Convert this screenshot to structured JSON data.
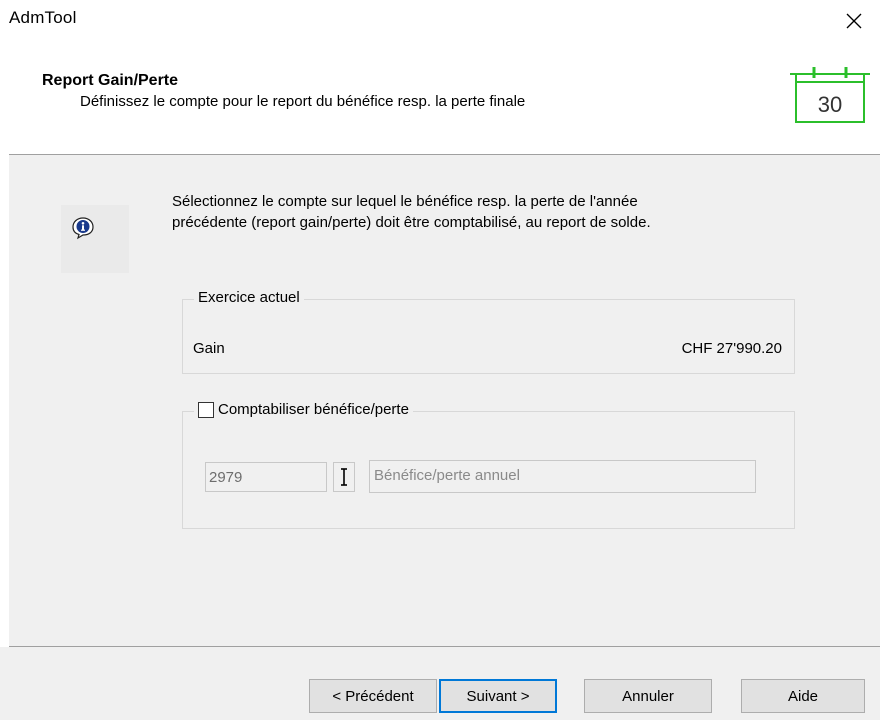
{
  "window": {
    "title": "AdmTool",
    "close_icon": "close-icon"
  },
  "header": {
    "title": "Report Gain/Perte",
    "subtitle": "Définissez le compte pour le report du bénéfice resp. la perte finale",
    "calendar_icon": "calendar-icon",
    "calendar_number": "30",
    "calendar_color": "#2bbf2b"
  },
  "body": {
    "info_icon": "info-icon",
    "instruction_line1": "Sélectionnez le compte sur lequel le bénéfice resp. la perte de l'année",
    "instruction_line2": "précédente (report gain/perte) doit être comptabilisé, au report de solde.",
    "current_year": {
      "legend": "Exercice actuel",
      "label": "Gain",
      "value": "CHF 27'990.20"
    },
    "booking": {
      "checkbox_label": "Comptabiliser bénéfice/perte",
      "checked": false,
      "account_number": "2979",
      "account_description": "Bénéfice/perte annuel",
      "lookup_icon": "text-cursor-icon"
    }
  },
  "footer": {
    "prev_label": "< Précédent",
    "next_label": "Suivant >",
    "cancel_label": "Annuler",
    "help_label": "Aide",
    "focus_color": "#0078d7"
  }
}
